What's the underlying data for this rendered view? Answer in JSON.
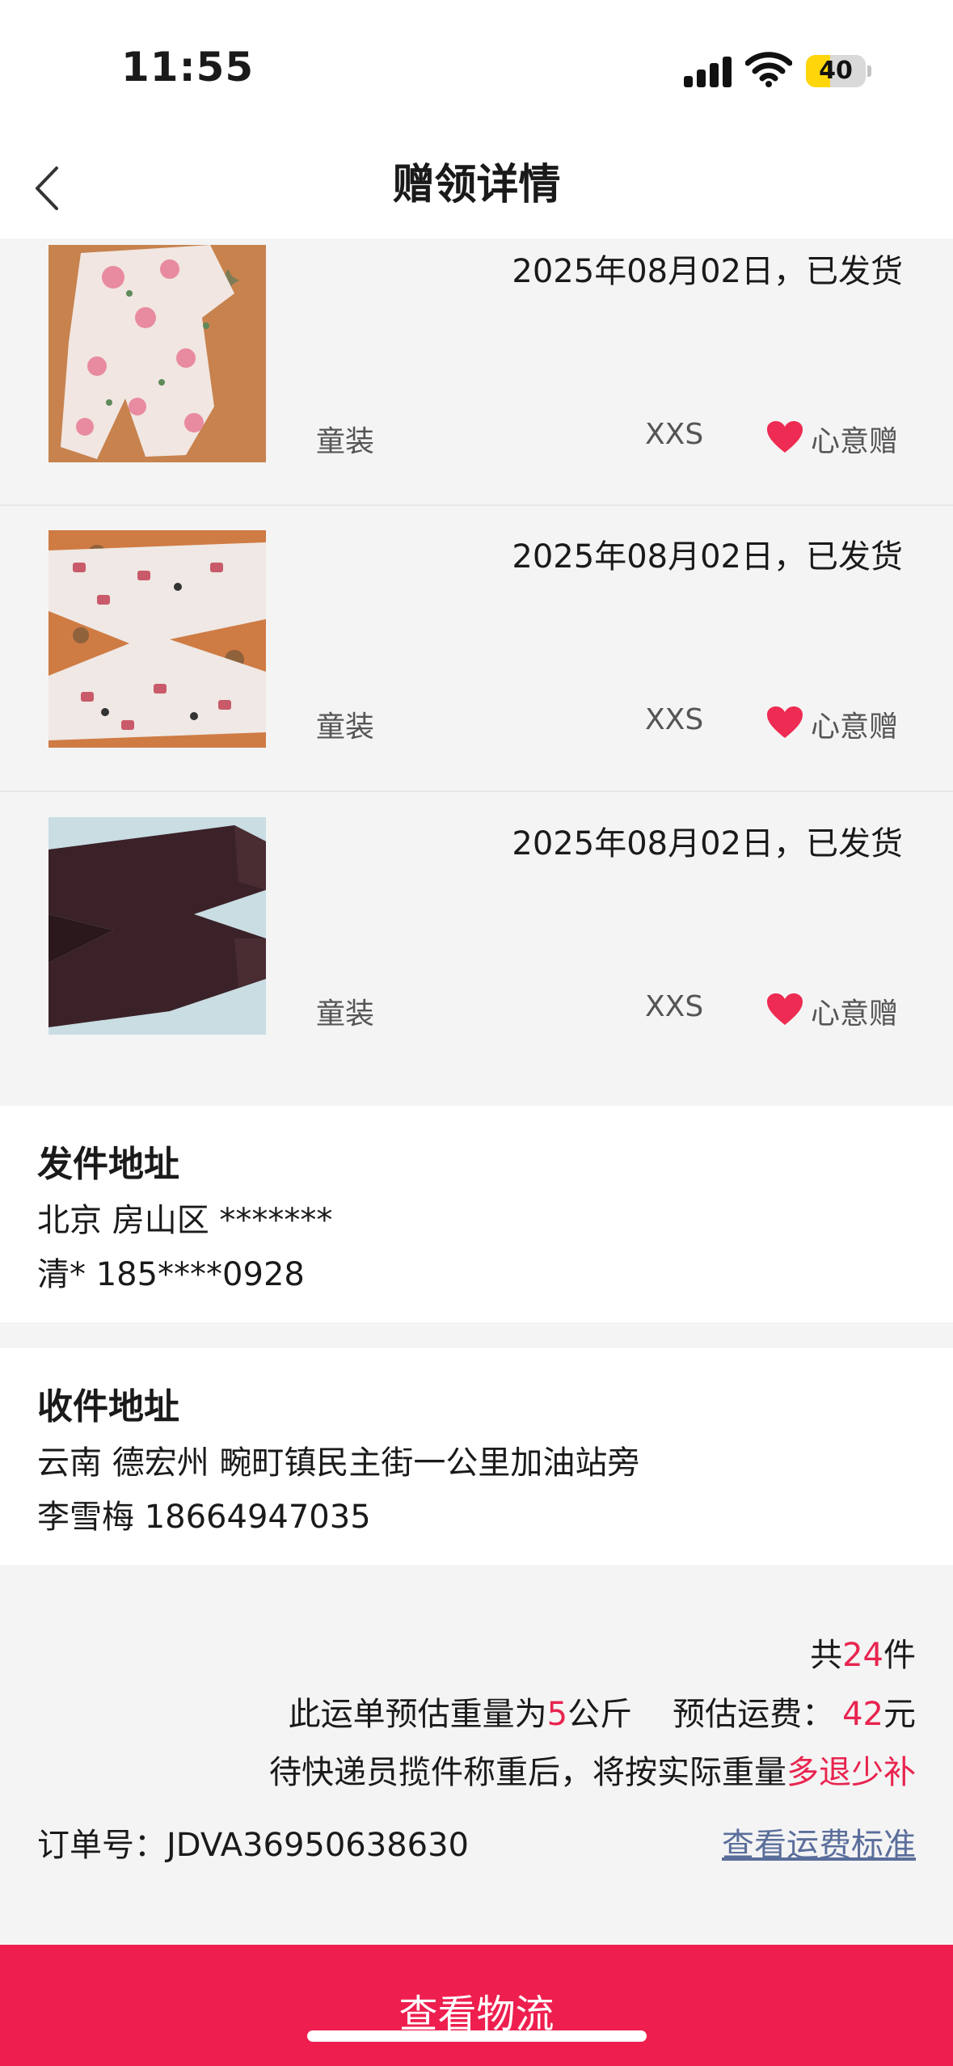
{
  "status": {
    "time": "11:55",
    "battery": "40",
    "battery_level": 0.4
  },
  "header": {
    "title": "赠领详情",
    "back_icon": "chevron-left-icon"
  },
  "items": [
    {
      "date_status": "2025年08月02日，已发货",
      "category": "童装",
      "size": "XXS",
      "tag": "心意赠",
      "tag_icon": "heart-icon"
    },
    {
      "date_status": "2025年08月02日，已发货",
      "category": "童装",
      "size": "XXS",
      "tag": "心意赠",
      "tag_icon": "heart-icon"
    },
    {
      "date_status": "2025年08月02日，已发货",
      "category": "童装",
      "size": "XXS",
      "tag": "心意赠",
      "tag_icon": "heart-icon"
    }
  ],
  "sender": {
    "title": "发件地址",
    "address": "北京 房山区 *******",
    "contact": "清* 185****0928"
  },
  "receiver": {
    "title": "收件地址",
    "address": "云南 德宏州 畹町镇民主街一公里加油站旁",
    "contact": "李雪梅 18664947035"
  },
  "summary": {
    "total_prefix": "共",
    "total_count": "24",
    "total_suffix": "件",
    "weight_prefix": "此运单预估重量为",
    "weight_value": "5",
    "weight_unit": "公斤",
    "fee_label": "预估运费：",
    "fee_value": "42",
    "fee_unit": "元",
    "note_prefix": "待快递员揽件称重后，将按实际重量",
    "note_highlight": "多退少补",
    "order_label": "订单号：",
    "order_number": "JDVA36950638630",
    "fee_link": "查看运费标准"
  },
  "bottom_button": {
    "label": "查看物流"
  },
  "colors": {
    "accent": "#ee1f4f",
    "highlight": "#e8244f",
    "link": "#5b6e9b",
    "background": "#f4f4f4"
  }
}
